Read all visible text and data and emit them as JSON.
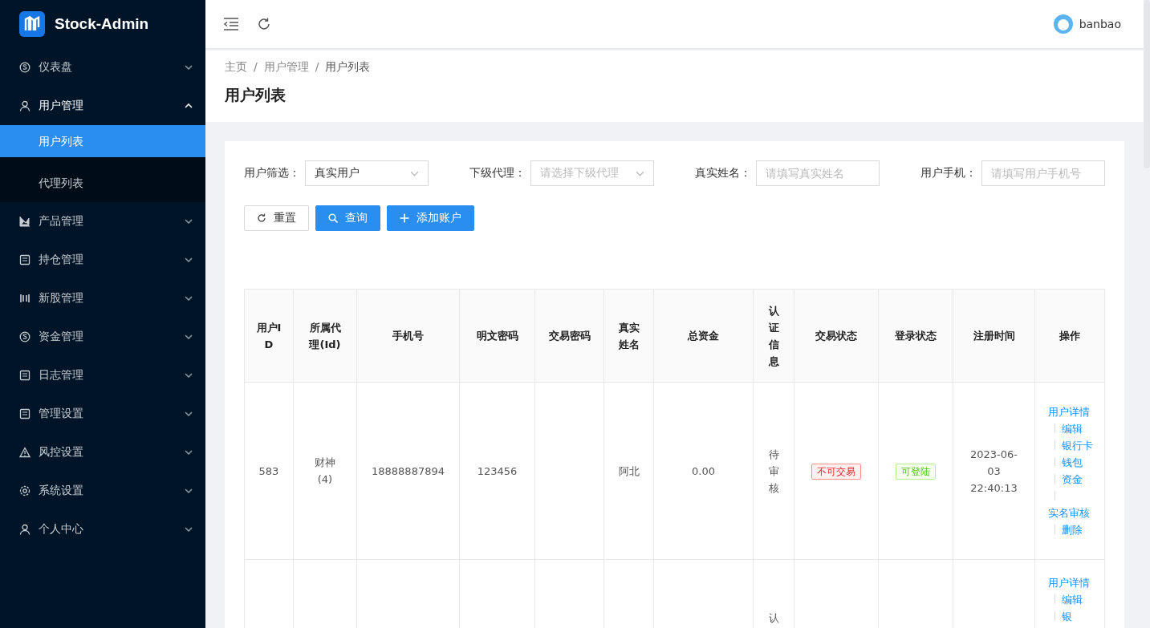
{
  "brand": "Stock-Admin",
  "menu": [
    {
      "label": "仪表盘",
      "expanded": false
    },
    {
      "label": "用户管理",
      "expanded": true,
      "children": [
        {
          "label": "用户列表",
          "selected": true
        },
        {
          "label": "代理列表",
          "selected": false
        }
      ]
    },
    {
      "label": "产品管理",
      "expanded": false
    },
    {
      "label": "持仓管理",
      "expanded": false
    },
    {
      "label": "新股管理",
      "expanded": false
    },
    {
      "label": "资金管理",
      "expanded": false
    },
    {
      "label": "日志管理",
      "expanded": false
    },
    {
      "label": "管理设置",
      "expanded": false
    },
    {
      "label": "风控设置",
      "expanded": false
    },
    {
      "label": "系统设置",
      "expanded": false
    },
    {
      "label": "个人中心",
      "expanded": false
    }
  ],
  "user": {
    "name": "banbao"
  },
  "breadcrumb": {
    "separator": "/",
    "items": [
      "主页",
      "用户管理",
      "用户列表"
    ]
  },
  "page_title": "用户列表",
  "filters": [
    {
      "label": "用户筛选：",
      "kind": "select",
      "value": "真实用户"
    },
    {
      "label": "下级代理：",
      "kind": "select",
      "placeholder": "请选择下级代理"
    },
    {
      "label": "真实姓名：",
      "kind": "input",
      "placeholder": "请填写真实姓名"
    },
    {
      "label": "用户手机：",
      "kind": "input",
      "placeholder": "请填写用户手机号"
    }
  ],
  "buttons": [
    {
      "label": "重置",
      "kind": "reset"
    },
    {
      "label": "查询",
      "kind": "search"
    },
    {
      "label": "添加账户",
      "kind": "add"
    }
  ],
  "table": {
    "columns": [
      "用户ID",
      "所属代理(Id)",
      "手机号",
      "明文密码",
      "交易密码",
      "真实姓名",
      "总资金",
      "认证信息",
      "交易状态",
      "登录状态",
      "注册时间",
      "操作"
    ],
    "rows": [
      {
        "id": "583",
        "agent": [
          "财神",
          "(4)"
        ],
        "phone": "18888887894",
        "password": "123456",
        "real_name": "阿北",
        "total": "0.00",
        "auth": "待审核",
        "trade_status": {
          "text": "不可交易",
          "kind": "danger"
        },
        "login_status": {
          "text": "可登陆",
          "kind": "success"
        },
        "registered": "2023-06-03 22:40:13",
        "actions": [
          "用户详情",
          "编辑",
          "银行卡",
          "钱包",
          "资金",
          "实名审核",
          "删除"
        ]
      },
      {
        "auth": "认",
        "actions": [
          "用户详情",
          "编辑",
          "银"
        ]
      }
    ]
  }
}
